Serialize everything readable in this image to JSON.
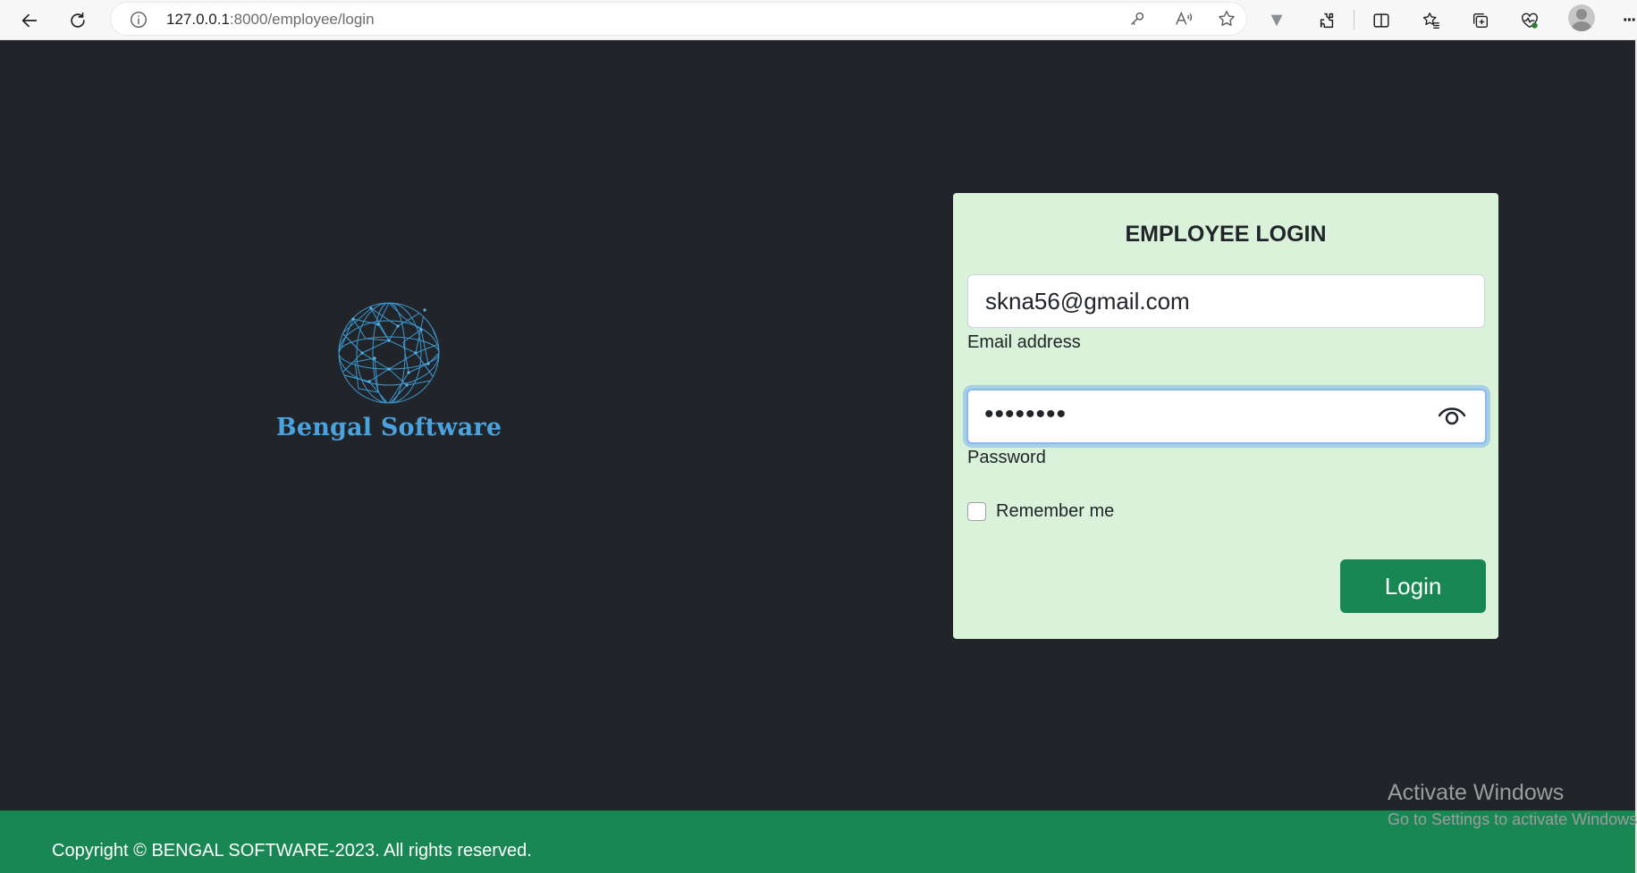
{
  "browser": {
    "url_host": "127.0.0.1",
    "url_path": ":8000/employee/login",
    "icons": [
      "back-arrow-icon",
      "refresh-icon",
      "info-icon",
      "key-icon",
      "read-aloud-icon",
      "favorite-star-icon",
      "extension-v-icon",
      "extensions-puzzle-icon",
      "split-screen-icon",
      "favorites-icon",
      "collections-icon",
      "browser-essentials-icon",
      "profile-avatar-icon",
      "more-menu-icon"
    ],
    "more_label": "···"
  },
  "brand": {
    "name": "Bengal Software",
    "logo_icon": "wireframe-globe-icon",
    "color": "#4aa3df"
  },
  "login": {
    "title": "EMPLOYEE LOGIN",
    "email_value": "skna56@gmail.com",
    "email_label": "Email address",
    "password_value": "••••••••",
    "password_label": "Password",
    "remember_label": "Remember me",
    "remember_checked": false,
    "button_label": "Login",
    "button_color": "#198754",
    "card_color": "#d9f2d9"
  },
  "footer": {
    "text": "Copyright © BENGAL SOFTWARE-2023. All rights reserved.",
    "color": "#198754"
  },
  "watermark": {
    "title": "Activate Windows",
    "subtitle": "Go to Settings to activate Windows."
  },
  "colors": {
    "page_background": "#212529"
  }
}
